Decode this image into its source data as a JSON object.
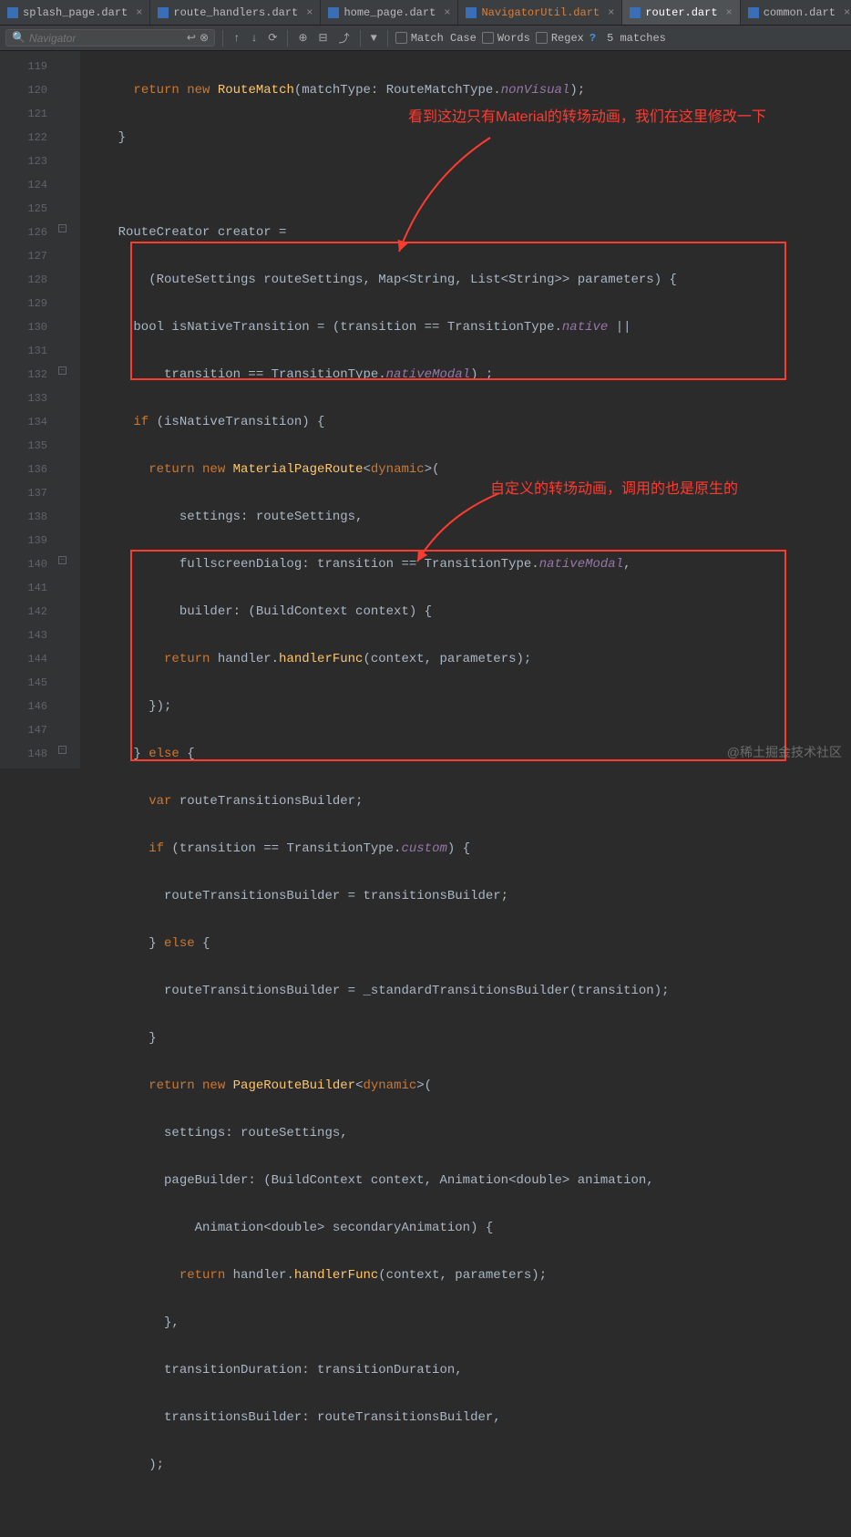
{
  "tabs": [
    {
      "label": "splash_page.dart"
    },
    {
      "label": "route_handlers.dart"
    },
    {
      "label": "home_page.dart"
    },
    {
      "label": "NavigatorUtil.dart"
    },
    {
      "label": "router.dart"
    },
    {
      "label": "common.dart"
    }
  ],
  "find": {
    "placeholder": "Navigator",
    "matchCase": "Match Case",
    "words": "Words",
    "regex": "Regex",
    "matches": "5 matches"
  },
  "lines": {
    "start": 119,
    "end": 148
  },
  "code": {
    "l119a": "return",
    "l119b": " new",
    "l119c": " RouteMatch",
    "l119d": "(matchType: RouteMatchType.",
    "l119e": "nonVisual",
    "l119f": ");",
    "l120": "    }",
    "l122": "    RouteCreator creator =",
    "l123": "        (RouteSettings routeSettings, Map<String, List<String>> parameters) {",
    "l124a": "      bool isNativeTransition = (transition == TransitionType.",
    "l124b": "native",
    "l124c": " ||",
    "l125a": "          transition == TransitionType.",
    "l125b": "nativeModal",
    "l125c": ") ;",
    "l126a": "      if",
    "l126b": " (isNativeTransition) {",
    "l127a": "        return",
    "l127b": " new",
    "l127c": " MaterialPageRoute",
    "l127d": "<",
    "l127e": "dynamic",
    "l127f": ">(",
    "l128": "            settings: routeSettings,",
    "l129a": "            fullscreenDialog: transition == TransitionType.",
    "l129b": "nativeModal",
    "l129c": ",",
    "l130": "            builder: (BuildContext context) {",
    "l131a": "          return",
    "l131b": " handler.",
    "l131c": "handlerFunc",
    "l131d": "(context, parameters);",
    "l132": "        });",
    "l133a": "      } ",
    "l133b": "else",
    "l133c": " {",
    "l134a": "        var",
    "l134b": " routeTransitionsBuilder;",
    "l135a": "        if",
    "l135b": " (transition == TransitionType.",
    "l135c": "custom",
    "l135d": ") {",
    "l136": "          routeTransitionsBuilder = transitionsBuilder;",
    "l137a": "        } ",
    "l137b": "else",
    "l137c": " {",
    "l138": "          routeTransitionsBuilder = _standardTransitionsBuilder(transition);",
    "l139": "        }",
    "l140a": "        return",
    "l140b": " new",
    "l140c": " PageRouteBuilder",
    "l140d": "<",
    "l140e": "dynamic",
    "l140f": ">(",
    "l141": "          settings: routeSettings,",
    "l142": "          pageBuilder: (BuildContext context, Animation<double> animation,",
    "l143": "              Animation<double> secondaryAnimation) {",
    "l144a": "            return",
    "l144b": " handler.",
    "l144c": "handlerFunc",
    "l144d": "(context, parameters);",
    "l145": "          },",
    "l146": "          transitionDuration: transitionDuration,",
    "l147": "          transitionsBuilder: routeTransitionsBuilder,",
    "l148": "        );"
  },
  "annotations": {
    "a1": "看到这边只有Material的转场动画，我们在这里修改一下",
    "a2": "自定义的转场动画，调用的也是原生的"
  },
  "watermark": "@稀土掘金技术社区"
}
